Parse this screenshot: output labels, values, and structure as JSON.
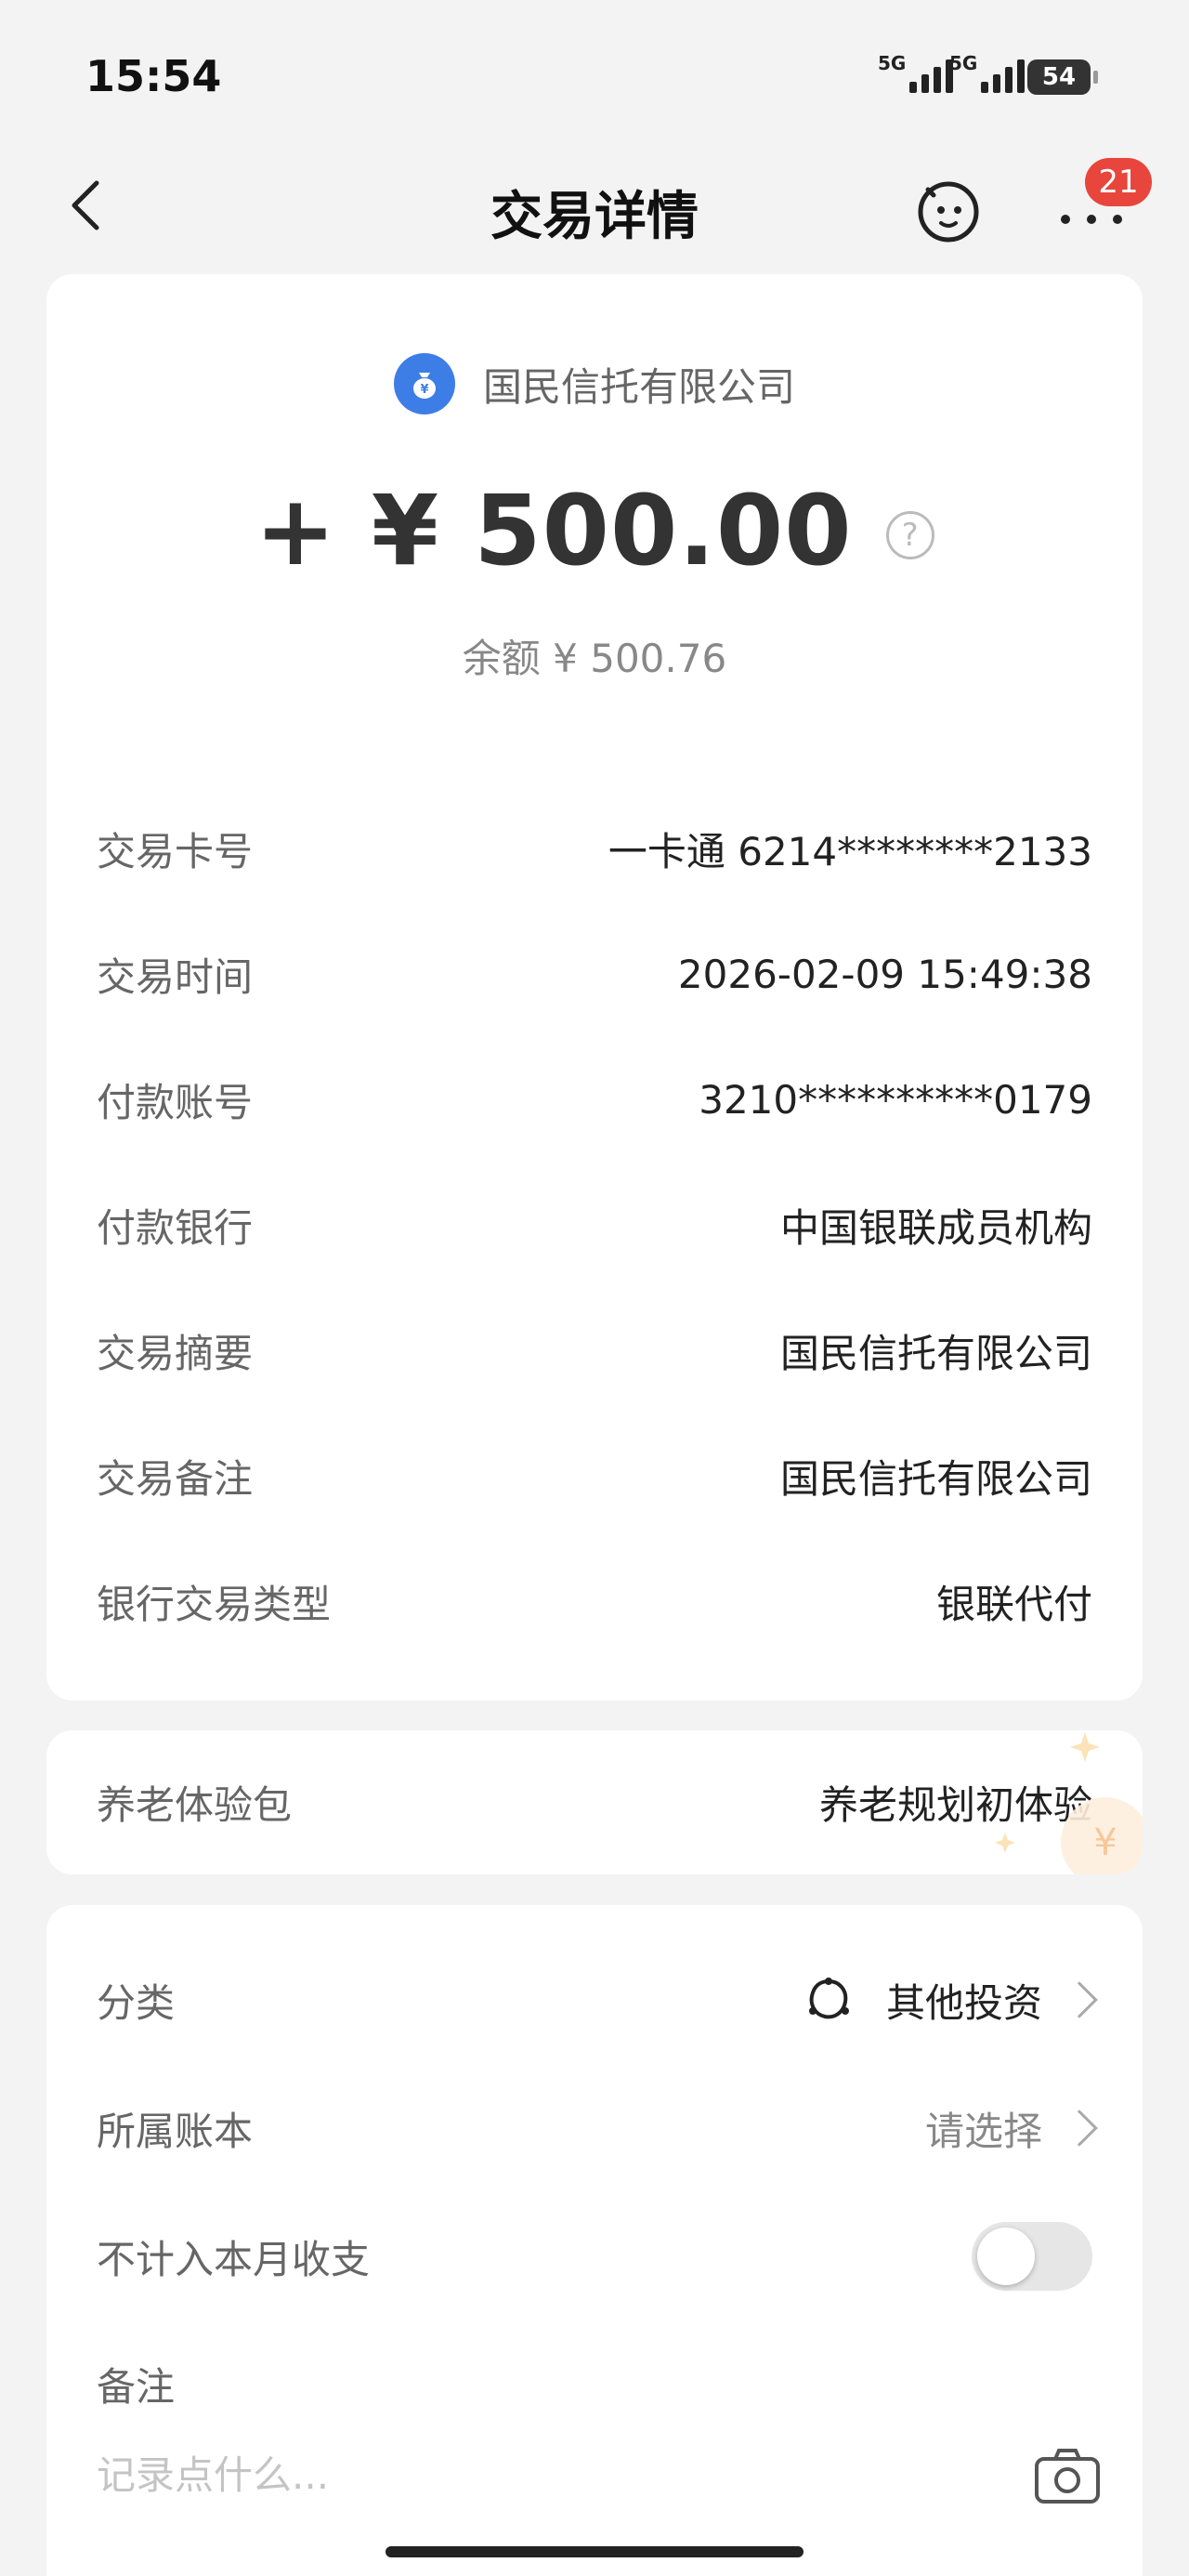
{
  "status_bar": {
    "time": "15:54",
    "network_1": "5G",
    "network_2": "5G",
    "battery": "54"
  },
  "nav": {
    "title": "交易详情",
    "badge_count": "21",
    "icons": [
      "back-arrow-icon",
      "robot-face-icon",
      "more-dots-icon"
    ]
  },
  "summary": {
    "merchant": "国民信托有限公司",
    "merchant_icon": "money-bag-icon",
    "amount": "+ ¥ 500.00",
    "balance": "余额 ¥ 500.76"
  },
  "details": [
    {
      "label": "交易卡号",
      "value": "一卡通 6214********2133"
    },
    {
      "label": "交易时间",
      "value": "2026-02-09 15:49:38"
    },
    {
      "label": "付款账号",
      "value": "3210**********0179"
    },
    {
      "label": "付款银行",
      "value": "中国银联成员机构"
    },
    {
      "label": "交易摘要",
      "value": "国民信托有限公司"
    },
    {
      "label": "交易备注",
      "value": "国民信托有限公司"
    },
    {
      "label": "银行交易类型",
      "value": "银联代付"
    }
  ],
  "pension": {
    "label": "养老体验包",
    "value": "养老规划初体验"
  },
  "settings": {
    "category_label": "分类",
    "category_value": "其他投资",
    "ledger_label": "所属账本",
    "ledger_value": "请选择",
    "exclude_label": "不计入本月收支",
    "exclude_enabled": false,
    "note_label": "备注",
    "note_placeholder": "记录点什么..."
  },
  "colors": {
    "accent_blue": "#3d7ee6",
    "badge_red": "#e8453c",
    "background": "#f3f3f3"
  }
}
